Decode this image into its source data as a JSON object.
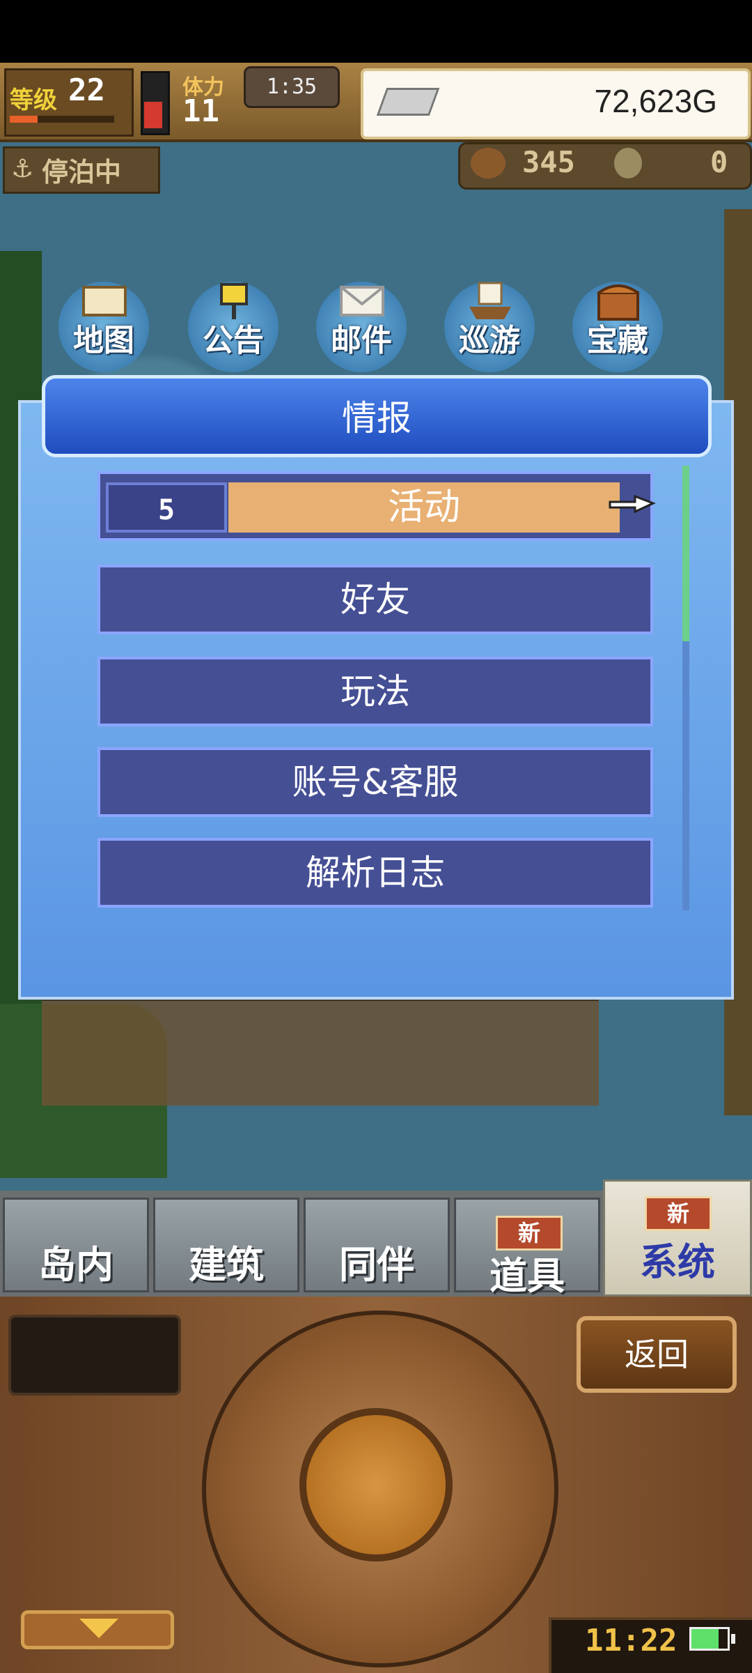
{
  "hud": {
    "level_label": "等级",
    "level_value": "22",
    "stamina_label": "体力",
    "stamina_value": "11",
    "timer": "1:35",
    "gold": "72,623G",
    "exp_fraction": 0.25,
    "stamina_fraction": 0.45
  },
  "status": {
    "anchor_label": "停泊中",
    "coins": "345",
    "tokens": "0"
  },
  "shortcuts": [
    {
      "label": "地图",
      "icon": "map-icon"
    },
    {
      "label": "公告",
      "icon": "notice-sign-icon"
    },
    {
      "label": "邮件",
      "icon": "mail-icon"
    },
    {
      "label": "巡游",
      "icon": "ship-icon"
    },
    {
      "label": "宝藏",
      "icon": "treasure-chest-icon"
    }
  ],
  "dialog": {
    "title": "情报",
    "event_count": "5",
    "items": [
      "活动",
      "好友",
      "玩法",
      "账号&客服",
      "解析日志"
    ]
  },
  "tabs": [
    {
      "label": "岛内"
    },
    {
      "label": "建筑"
    },
    {
      "label": "同伴"
    },
    {
      "label": "道具",
      "badge": "新"
    },
    {
      "label": "系统",
      "badge": "新",
      "active": true
    }
  ],
  "controller": {
    "back_label": "返回",
    "clock": "11:22"
  },
  "colors": {
    "dialog_header": "#1f4dbf",
    "menu_item": "#454f94",
    "event_highlight": "#e8b073",
    "active_tab_text": "#2d3aa8"
  }
}
